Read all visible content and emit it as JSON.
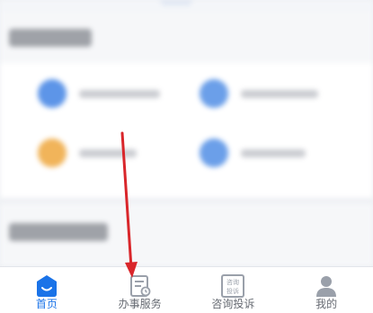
{
  "tabbar": {
    "active_index": 0,
    "tabs": [
      {
        "label": "首页",
        "icon": "home-icon"
      },
      {
        "label": "办事服务",
        "icon": "service-list-icon"
      },
      {
        "label": "咨询投诉",
        "icon": "consult-complaint-icon",
        "icon_text": "咨询 投诉"
      },
      {
        "label": "我的",
        "icon": "user-profile-icon"
      }
    ]
  },
  "colors": {
    "accent": "#1a73e8",
    "annotation_arrow": "#d9262b",
    "tab_inactive": "#666a72"
  }
}
